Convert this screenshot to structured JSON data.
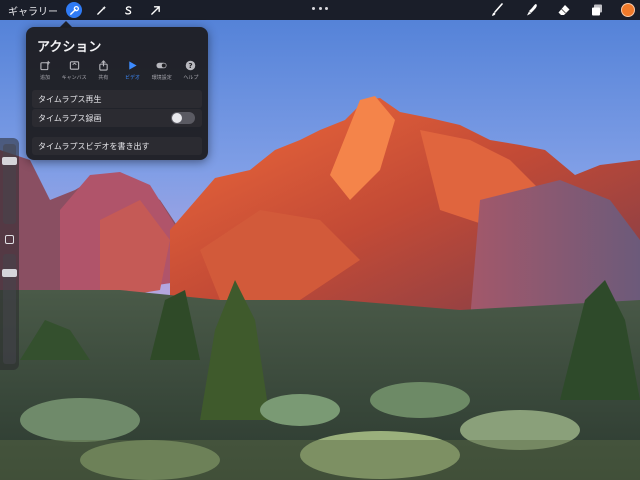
{
  "toolbar": {
    "gallery_label": "ギャラリー",
    "left_tools": [
      {
        "icon": "wrench-icon",
        "active": true
      },
      {
        "icon": "magic-wand-icon",
        "active": false
      },
      {
        "icon": "selection-s-icon",
        "active": false
      },
      {
        "icon": "transform-arrow-icon",
        "active": false
      }
    ],
    "right_tools": [
      "brush-icon",
      "smudge-icon",
      "eraser-icon",
      "layers-icon"
    ],
    "current_color": "#f07a2a",
    "accent_color": "#2f7bf5"
  },
  "actions_panel": {
    "title": "アクション",
    "tabs": [
      {
        "label": "追加",
        "icon": "add-image-icon",
        "active": false
      },
      {
        "label": "キャンバス",
        "icon": "canvas-icon",
        "active": false
      },
      {
        "label": "共有",
        "icon": "share-icon",
        "active": false
      },
      {
        "label": "ビデオ",
        "icon": "video-play-icon",
        "active": true
      },
      {
        "label": "環境設定",
        "icon": "prefs-toggle-icon",
        "active": false
      },
      {
        "label": "ヘルプ",
        "icon": "help-icon",
        "active": false
      }
    ],
    "rows": {
      "timelapse_replay": "タイムラプス再生",
      "timelapse_record": "タイムラプス録画",
      "timelapse_export": "タイムラプスビデオを書き出す"
    },
    "timelapse_record_enabled": false
  },
  "sidebar": {
    "brush_size_level": 0.82,
    "opacity_level": 0.85
  }
}
